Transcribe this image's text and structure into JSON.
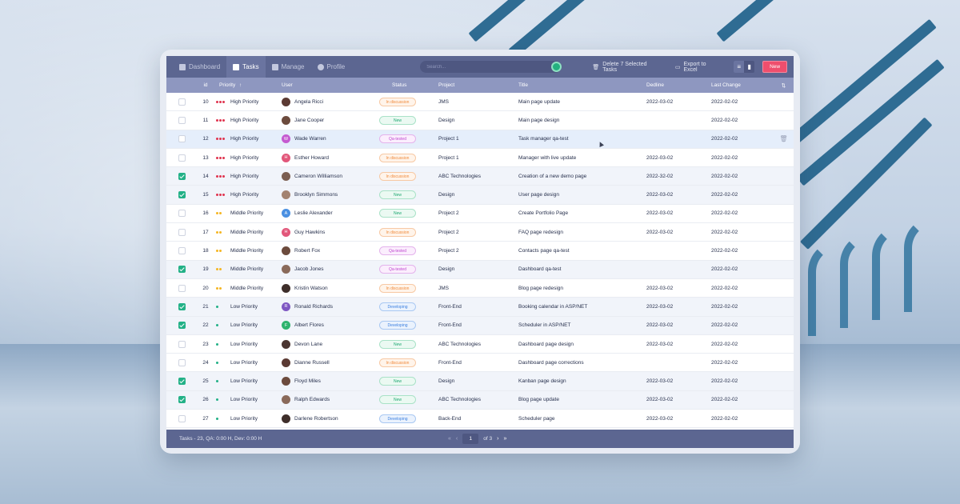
{
  "nav": {
    "items": [
      {
        "label": "Dashboard",
        "icon": "dashboard-icon",
        "active": false
      },
      {
        "label": "Tasks",
        "icon": "tasks-icon",
        "active": true
      },
      {
        "label": "Manage",
        "icon": "manage-icon",
        "active": false
      },
      {
        "label": "Profile",
        "icon": "profile-icon",
        "active": false
      }
    ]
  },
  "search": {
    "placeholder": "Search..."
  },
  "toolbar": {
    "delete_label": "Delete 7 Selected Tasks",
    "export_label": "Export to Excel",
    "new_label": "New",
    "view_mode": "list"
  },
  "table": {
    "headers": {
      "id": "id",
      "priority": "Priority",
      "user": "User",
      "status": "Status",
      "project": "Project",
      "title": "Title",
      "deadline": "Dedline",
      "last_change": "Last Change"
    },
    "rows": [
      {
        "checked": false,
        "id": "10",
        "priority": "High Priority",
        "user": "Angela Ricci",
        "avatar": "photo",
        "status": "In discussion",
        "project": "JMS",
        "title": "Main page update",
        "deadline": "2022-03-02",
        "last_change": "2022-02-02"
      },
      {
        "checked": false,
        "id": "11",
        "priority": "High Priority",
        "user": "Jane Cooper",
        "avatar": "photo",
        "status": "New",
        "project": "Design",
        "title": "Main page design",
        "deadline": "",
        "last_change": "2022-02-02"
      },
      {
        "checked": false,
        "id": "12",
        "priority": "High Priority",
        "user": "Wade Warren",
        "avatar": "W",
        "status": "Qa-tested",
        "project": "Project 1",
        "title": "Task manager qa-test",
        "deadline": "",
        "last_change": "2022-02-02",
        "hover": true
      },
      {
        "checked": false,
        "id": "13",
        "priority": "High Priority",
        "user": "Esther Howard",
        "avatar": "H",
        "status": "In discussion",
        "project": "Project 1",
        "title": "Manager with live update",
        "deadline": "2022-03-02",
        "last_change": "2022-02-02"
      },
      {
        "checked": true,
        "id": "14",
        "priority": "High Priority",
        "user": "Cameron Williamson",
        "avatar": "photo",
        "status": "In discussion",
        "project": "ABC Technologies",
        "title": "Creation of a new demo page",
        "deadline": "2022-32-02",
        "last_change": "2022-02-02"
      },
      {
        "checked": true,
        "id": "15",
        "priority": "High Priority",
        "user": "Brooklyn Simmons",
        "avatar": "photo",
        "status": "New",
        "project": "Design",
        "title": "User page design",
        "deadline": "2022-03-02",
        "last_change": "2022-02-02"
      },
      {
        "checked": false,
        "id": "16",
        "priority": "Middle Priority",
        "user": "Leslie Alexander",
        "avatar": "A",
        "status": "New",
        "project": "Project 2",
        "title": "Create Portfolio Page",
        "deadline": "2022-03-02",
        "last_change": "2022-02-02"
      },
      {
        "checked": false,
        "id": "17",
        "priority": "Middle Priority",
        "user": "Guy Hawkins",
        "avatar": "H",
        "status": "In discussion",
        "project": "Project 2",
        "title": "FAQ page redesign",
        "deadline": "2022-03-02",
        "last_change": "2022-02-02"
      },
      {
        "checked": false,
        "id": "18",
        "priority": "Middle Priority",
        "user": "Robert Fox",
        "avatar": "photo",
        "status": "Qa-tested",
        "project": "Project 2",
        "title": "Contacts page qa-test",
        "deadline": "",
        "last_change": "2022-02-02"
      },
      {
        "checked": true,
        "id": "19",
        "priority": "Middle Priority",
        "user": "Jacob Jones",
        "avatar": "photo",
        "status": "Qa-tested",
        "project": "Design",
        "title": "Dashboard qa-test",
        "deadline": "",
        "last_change": "2022-02-02"
      },
      {
        "checked": false,
        "id": "20",
        "priority": "Middle Priority",
        "user": "Kristin Watson",
        "avatar": "photo",
        "status": "In discussion",
        "project": "JMS",
        "title": "Blog page redesign",
        "deadline": "2022-03-02",
        "last_change": "2022-02-02"
      },
      {
        "checked": true,
        "id": "21",
        "priority": "Low Priority",
        "user": "Ronald Richards",
        "avatar": "R",
        "status": "Developing",
        "project": "Front-End",
        "title": "Booking calendar in ASP/NET",
        "deadline": "2022-03-02",
        "last_change": "2022-02-02"
      },
      {
        "checked": true,
        "id": "22",
        "priority": "Low Priority",
        "user": "Albert Flores",
        "avatar": "F",
        "status": "Developing",
        "project": "Front-End",
        "title": "Scheduler in ASP/NET",
        "deadline": "2022-03-02",
        "last_change": "2022-02-02"
      },
      {
        "checked": false,
        "id": "23",
        "priority": "Low Priority",
        "user": "Devon Lane",
        "avatar": "photo",
        "status": "New",
        "project": "ABC Technologies",
        "title": "Dashboard page design",
        "deadline": "2022-03-02",
        "last_change": "2022-02-02"
      },
      {
        "checked": false,
        "id": "24",
        "priority": "Low Priority",
        "user": "Dianne Russell",
        "avatar": "photo",
        "status": "In discussion",
        "project": "Front-End",
        "title": "Dashboard page corrections",
        "deadline": "",
        "last_change": "2022-02-02"
      },
      {
        "checked": true,
        "id": "25",
        "priority": "Low Priority",
        "user": "Floyd Miles",
        "avatar": "photo",
        "status": "New",
        "project": "Design",
        "title": "Kanban page design",
        "deadline": "2022-03-02",
        "last_change": "2022-02-02"
      },
      {
        "checked": true,
        "id": "26",
        "priority": "Low Priority",
        "user": "Ralph Edwards",
        "avatar": "photo",
        "status": "New",
        "project": "ABC Technologies",
        "title": "Blog page update",
        "deadline": "2022-03-02",
        "last_change": "2022-02-02"
      },
      {
        "checked": false,
        "id": "27",
        "priority": "Low Priority",
        "user": "Darlene Robertson",
        "avatar": "photo",
        "status": "Developing",
        "project": "Back-End",
        "title": "Scheduler page",
        "deadline": "2022-03-02",
        "last_change": "2022-02-02"
      }
    ]
  },
  "footer": {
    "summary": "Tasks - 23, QA: 0:00 H, Dev: 0:00 H",
    "current_page": "1",
    "of_pages": "of 3"
  },
  "colors": {
    "topbar": "#5c6691",
    "header": "#8e97c0",
    "accent_new": "#ef4e6d",
    "check": "#23b187",
    "priority_high": "#e0344f",
    "priority_middle": "#f5b623",
    "priority_low": "#23b187"
  }
}
